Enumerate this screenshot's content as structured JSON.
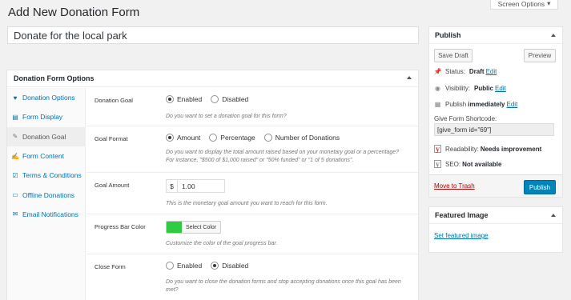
{
  "header": {
    "page_title": "Add New Donation Form",
    "screen_options": "Screen Options"
  },
  "post_title": "Donate for the local park",
  "panel": {
    "title": "Donation Form Options",
    "tabs": [
      {
        "label": "Donation Options",
        "icon": "heart-icon"
      },
      {
        "label": "Form Display",
        "icon": "document-icon"
      },
      {
        "label": "Donation Goal",
        "icon": "wrench-icon"
      },
      {
        "label": "Form Content",
        "icon": "edit-icon"
      },
      {
        "label": "Terms & Conditions",
        "icon": "checklist-icon"
      },
      {
        "label": "Offline Donations",
        "icon": "card-icon"
      },
      {
        "label": "Email Notifications",
        "icon": "email-icon"
      }
    ],
    "rows": {
      "goal": {
        "label": "Donation Goal",
        "enabled": "Enabled",
        "disabled": "Disabled",
        "desc": "Do you want to set a donation goal for this form?"
      },
      "format": {
        "label": "Goal Format",
        "amount": "Amount",
        "percentage": "Percentage",
        "number": "Number of Donations",
        "desc": "Do you want to display the total amount raised based on your monetary goal or a percentage? For instance, \"$500 of $1,000 raised\" or \"50% funded\" or \"1 of 5 donations\"."
      },
      "amount": {
        "label": "Goal Amount",
        "currency": "$",
        "value": "1.00",
        "desc": "This is the monetary goal amount you want to reach for this form."
      },
      "color": {
        "label": "Progress Bar Color",
        "button": "Select Color",
        "swatch": "#2ecc40",
        "desc": "Customize the color of the goal progress bar."
      },
      "close": {
        "label": "Close Form",
        "enabled": "Enabled",
        "disabled": "Disabled",
        "desc": "Do you want to close the donation forms and stop accepting donations once this goal has been met?"
      }
    }
  },
  "publish": {
    "title": "Publish",
    "save_draft": "Save Draft",
    "preview": "Preview",
    "status_label": "Status:",
    "status_value": "Draft",
    "visibility_label": "Visibility:",
    "visibility_value": "Public",
    "publish_label": "Publish",
    "publish_value": "immediately",
    "edit": "Edit",
    "shortcode_label": "Give Form Shortcode:",
    "shortcode": "[give_form id=\"69\"]",
    "readability_label": "Readability:",
    "readability_value": "Needs improvement",
    "seo_label": "SEO:",
    "seo_value": "Not available",
    "trash": "Move to Trash",
    "publish_button": "Publish"
  },
  "featured": {
    "title": "Featured Image",
    "link": "Set featured image"
  }
}
